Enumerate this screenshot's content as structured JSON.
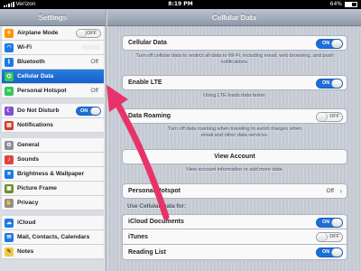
{
  "statusbar": {
    "carrier": "Verizon",
    "time": "8:19 PM",
    "battery": "64%"
  },
  "sidebar": {
    "title": "Settings",
    "groups": [
      {
        "items": [
          {
            "label": "Airplane Mode",
            "icon": "airplane-icon",
            "color": "#ff9500",
            "toggle": "OFF"
          },
          {
            "label": "Wi-Fi",
            "icon": "wifi-icon",
            "color": "#1b7ae3",
            "value": ""
          },
          {
            "label": "Bluetooth",
            "icon": "bluetooth-icon",
            "color": "#1b7ae3",
            "value": "Off"
          },
          {
            "label": "Cellular Data",
            "icon": "antenna-icon",
            "color": "#34c759",
            "selected": true
          },
          {
            "label": "Personal Hotspot",
            "icon": "hotspot-icon",
            "color": "#34c759",
            "value": "Off"
          }
        ]
      },
      {
        "items": [
          {
            "label": "Do Not Disturb",
            "icon": "moon-icon",
            "color": "#7d4fd6",
            "toggle": "ON"
          },
          {
            "label": "Notifications",
            "icon": "notifications-icon",
            "color": "#d93a2b"
          }
        ]
      },
      {
        "items": [
          {
            "label": "General",
            "icon": "gear-icon",
            "color": "#8e8e93"
          },
          {
            "label": "Sounds",
            "icon": "speaker-icon",
            "color": "#e0443c"
          },
          {
            "label": "Brightness & Wallpaper",
            "icon": "sun-icon",
            "color": "#1b7ae3"
          },
          {
            "label": "Picture Frame",
            "icon": "picture-frame-icon",
            "color": "#6b8e23"
          },
          {
            "label": "Privacy",
            "icon": "hand-icon",
            "color": "#8e8e93"
          }
        ]
      },
      {
        "items": [
          {
            "label": "iCloud",
            "icon": "cloud-icon",
            "color": "#1b7ae3"
          },
          {
            "label": "Mail, Contacts, Calendars",
            "icon": "mail-icon",
            "color": "#1b7ae3"
          },
          {
            "label": "Notes",
            "icon": "notes-icon",
            "color": "#f2c94c"
          }
        ]
      }
    ]
  },
  "main": {
    "title": "Cellular Data",
    "cellular_data": {
      "label": "Cellular Data",
      "toggle": "ON",
      "footnote": "Turn off cellular data to restrict all data to Wi-Fi, including email, web browsing, and push notifications."
    },
    "enable_lte": {
      "label": "Enable LTE",
      "toggle": "ON",
      "footnote": "Using LTE loads data faster."
    },
    "data_roaming": {
      "label": "Data Roaming",
      "toggle": "OFF",
      "footnote_a": "Turn off data roaming when traveling to avoid charges when",
      "footnote_b": "email and other data services."
    },
    "view_account": {
      "label": "View Account",
      "footnote": "View account information or add more data."
    },
    "personal_hotspot": {
      "label": "Personal Hotspot",
      "value": "Off"
    },
    "use_cellular_label": "Use Cellular Data for:",
    "apps": [
      {
        "label": "iCloud Documents",
        "toggle": "ON"
      },
      {
        "label": "iTunes",
        "toggle": "OFF"
      },
      {
        "label": "Reading List",
        "toggle": "ON"
      }
    ]
  },
  "annotation_color": "#e8336a"
}
